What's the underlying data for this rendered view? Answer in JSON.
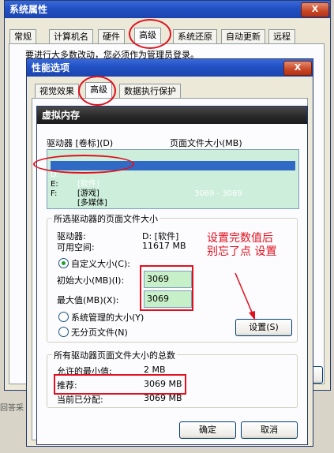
{
  "sysprops": {
    "title": "系统属性",
    "close": "X",
    "tabs": [
      "常规",
      "计算机名",
      "硬件",
      "高级",
      "系统还原",
      "自动更新",
      "远程"
    ],
    "notice": "要进行大多数改动，您必须作为管理员登录。"
  },
  "perf": {
    "title": "性能选项",
    "close": "X",
    "tabs": [
      "视觉效果",
      "高级",
      "数据执行保护"
    ]
  },
  "vm": {
    "title": "虚拟内存",
    "col_drive": "驱动器 [卷标](D)",
    "col_size": "页面文件大小(MB)",
    "drives": [
      {
        "drive": "C:",
        "label": "",
        "size": ""
      },
      {
        "drive": "D:",
        "label": "[软件]",
        "size": "3069 - 3069"
      },
      {
        "drive": "E:",
        "label": "[游戏]",
        "size": ""
      },
      {
        "drive": "F:",
        "label": "[多媒体]",
        "size": ""
      }
    ],
    "selected_group": "所选驱动器的页面文件大小",
    "drive_label": "驱动器:",
    "drive_value": "D:  [软件]",
    "space_label": "可用空间:",
    "space_value": "11617 MB",
    "custom_label": "自定义大小(C):",
    "initial_label": "初始大小(MB)(I):",
    "initial_value": "3069",
    "max_label": "最大值(MB)(X):",
    "max_value": "3069",
    "system_label": "系统管理的大小(Y)",
    "nopaging_label": "无分页文件(N)",
    "set_button": "设置(S)",
    "total_group": "所有驱动器页面文件大小的总数",
    "min_label": "允许的最小值:",
    "min_value": "2 MB",
    "rec_label": "推荐:",
    "rec_value": "3069 MB",
    "cur_label": "当前已分配:",
    "cur_value": "3069 MB",
    "ok": "确定",
    "cancel": "取消"
  },
  "annotation": {
    "line1": "设置完数值后",
    "line2": "别忘了点 设置"
  },
  "background": {
    "left_text": "回答采"
  },
  "colors": {
    "annotation": "#e0101e",
    "highlight_field": "#c8f0c8"
  }
}
